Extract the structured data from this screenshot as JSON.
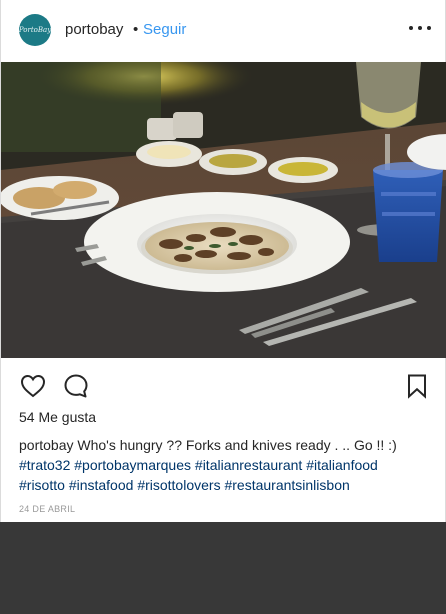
{
  "header": {
    "avatar_text": "PortoBay",
    "username": "portobay",
    "separator": "•",
    "follow_label": "Seguir"
  },
  "photo": {
    "description_icon": "food-photo"
  },
  "actions": {
    "like_icon": "heart-icon",
    "comment_icon": "comment-icon",
    "save_icon": "bookmark-icon"
  },
  "likes": "54 Me gusta",
  "caption": {
    "username": "portobay",
    "text": "Who's hungry ?? Forks and knives ready . .. Go !! :)",
    "hashtags": [
      "#trato32",
      "#portobaymarques",
      "#italianrestaurant",
      "#italianfood",
      "#risotto",
      "#instafood",
      "#risottolovers",
      "#restaurantsinlisbon"
    ]
  },
  "date": "24 DE ABRIL",
  "colors": {
    "link": "#3897f0",
    "hashtag": "#003569",
    "muted": "#999999",
    "avatar": "#1c7a86",
    "bottom_panel": "#383838"
  }
}
